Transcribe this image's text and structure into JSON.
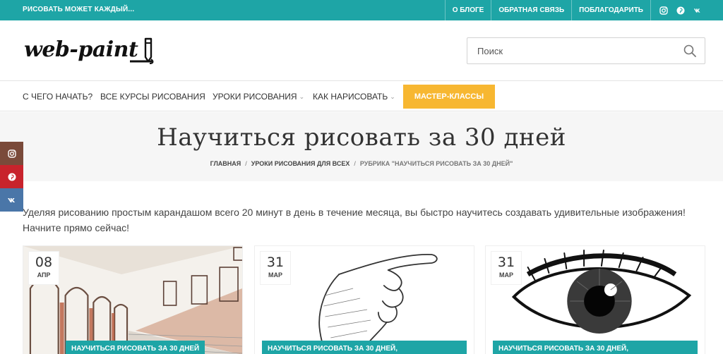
{
  "topbar": {
    "tagline": "РИСОВАТЬ МОЖЕТ КАЖДЫЙ...",
    "links": [
      "О БЛОГЕ",
      "ОБРАТНАЯ СВЯЗЬ",
      "ПОБЛАГОДАРИТЬ"
    ],
    "social_icons": [
      "instagram-icon",
      "pinterest-icon",
      "vk-icon"
    ],
    "bg_color": "#1ea5a6"
  },
  "header": {
    "logo_text": "web-paint",
    "search": {
      "placeholder": "Поиск"
    }
  },
  "nav": {
    "items": [
      {
        "label": "С ЧЕГО НАЧАТЬ?"
      },
      {
        "label": "ВСЕ КУРСЫ РИСОВАНИЯ"
      },
      {
        "label": "УРОКИ РИСОВАНИЯ"
      },
      {
        "label": "КАК НАРИСОВАТЬ"
      }
    ],
    "cta": {
      "label": "МАСТЕР-КЛАССЫ",
      "color": "#f7b731"
    }
  },
  "hero": {
    "title": "Научиться рисовать за 30 дней",
    "breadcrumbs": [
      "ГЛАВНАЯ",
      "УРОКИ РИСОВАНИЯ ДЛЯ ВСЕХ",
      "РУБРИКА \"НАУЧИТЬСЯ РИСОВАТЬ ЗА 30 ДНЕЙ\""
    ]
  },
  "side_social": [
    "instagram-icon",
    "pinterest-icon",
    "vk-icon"
  ],
  "intro": "Уделяя рисованию простым карандашом всего 20 минут в день в течение месяца, вы быстро научитесь создавать удивительные изображения! Начните прямо сейчас!",
  "cards": [
    {
      "day": "08",
      "month": "АПР",
      "category": "НАУЧИТЬСЯ РИСОВАТЬ ЗА 30 ДНЕЙ"
    },
    {
      "day": "31",
      "month": "МАР",
      "category": "НАУЧИТЬСЯ РИСОВАТЬ ЗА 30 ДНЕЙ,"
    },
    {
      "day": "31",
      "month": "МАР",
      "category": "НАУЧИТЬСЯ РИСОВАТЬ ЗА 30 ДНЕЙ,"
    }
  ]
}
